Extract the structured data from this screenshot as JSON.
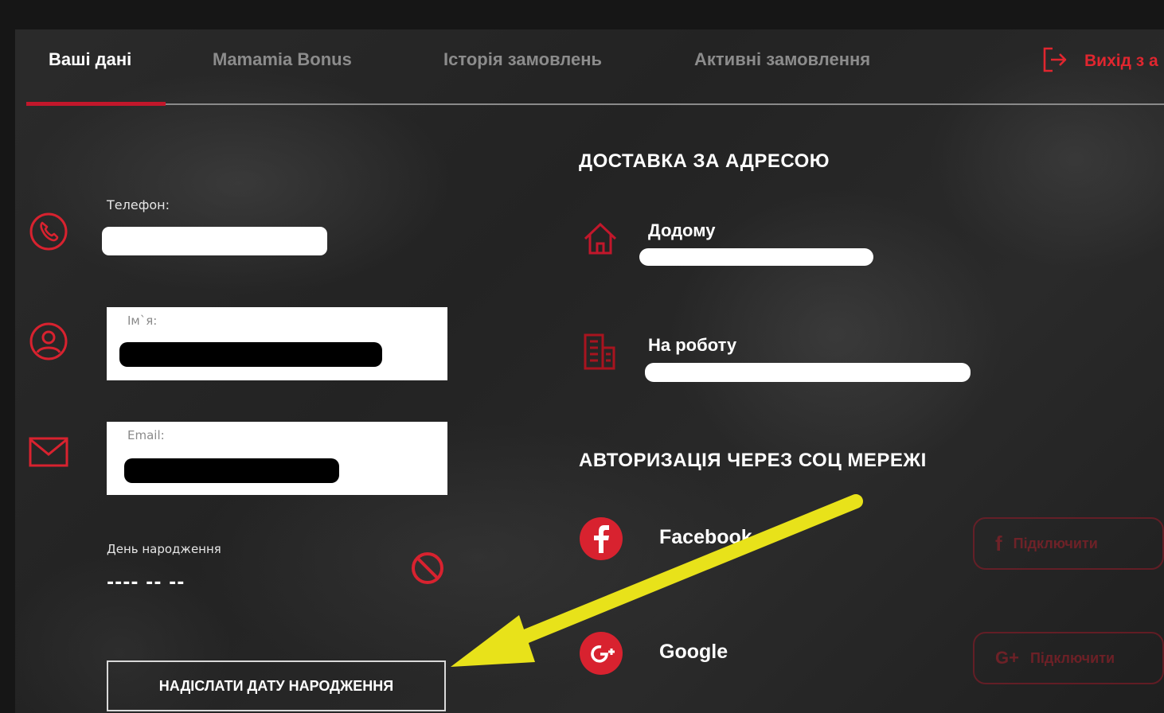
{
  "tabs": [
    {
      "label": "Ваші дані",
      "active": true
    },
    {
      "label": "Mamamia Bonus",
      "active": false
    },
    {
      "label": "Історія замовлень",
      "active": false
    },
    {
      "label": "Активні замовлення",
      "active": false
    }
  ],
  "logout": {
    "label": "Вихід з а",
    "icon": "logout-icon"
  },
  "personal": {
    "phone": {
      "label": "Телефон:",
      "value": ""
    },
    "name": {
      "label": "Ім`я:",
      "value": ""
    },
    "email": {
      "label": "Email:",
      "value": ""
    },
    "birthday": {
      "label": "День народження",
      "value": "---- -- --"
    },
    "send_birthday_button": "НАДІСЛАТИ ДАТУ НАРОДЖЕННЯ"
  },
  "delivery": {
    "title": "ДОСТАВКА ЗА АДРЕСОЮ",
    "home": {
      "label": "Додому",
      "icon": "home-icon"
    },
    "work": {
      "label": "На роботу",
      "icon": "building-icon"
    }
  },
  "social": {
    "title": "АВТОРИЗАЦІЯ ЧЕРЕЗ СОЦ МЕРЕЖІ",
    "facebook": {
      "label": "Facebook",
      "button": "Підключити"
    },
    "google": {
      "label": "Google",
      "button": "Підключити"
    }
  },
  "colors": {
    "accent": "#c2172b",
    "arrow": "#e8e21a",
    "background": "#262626"
  }
}
